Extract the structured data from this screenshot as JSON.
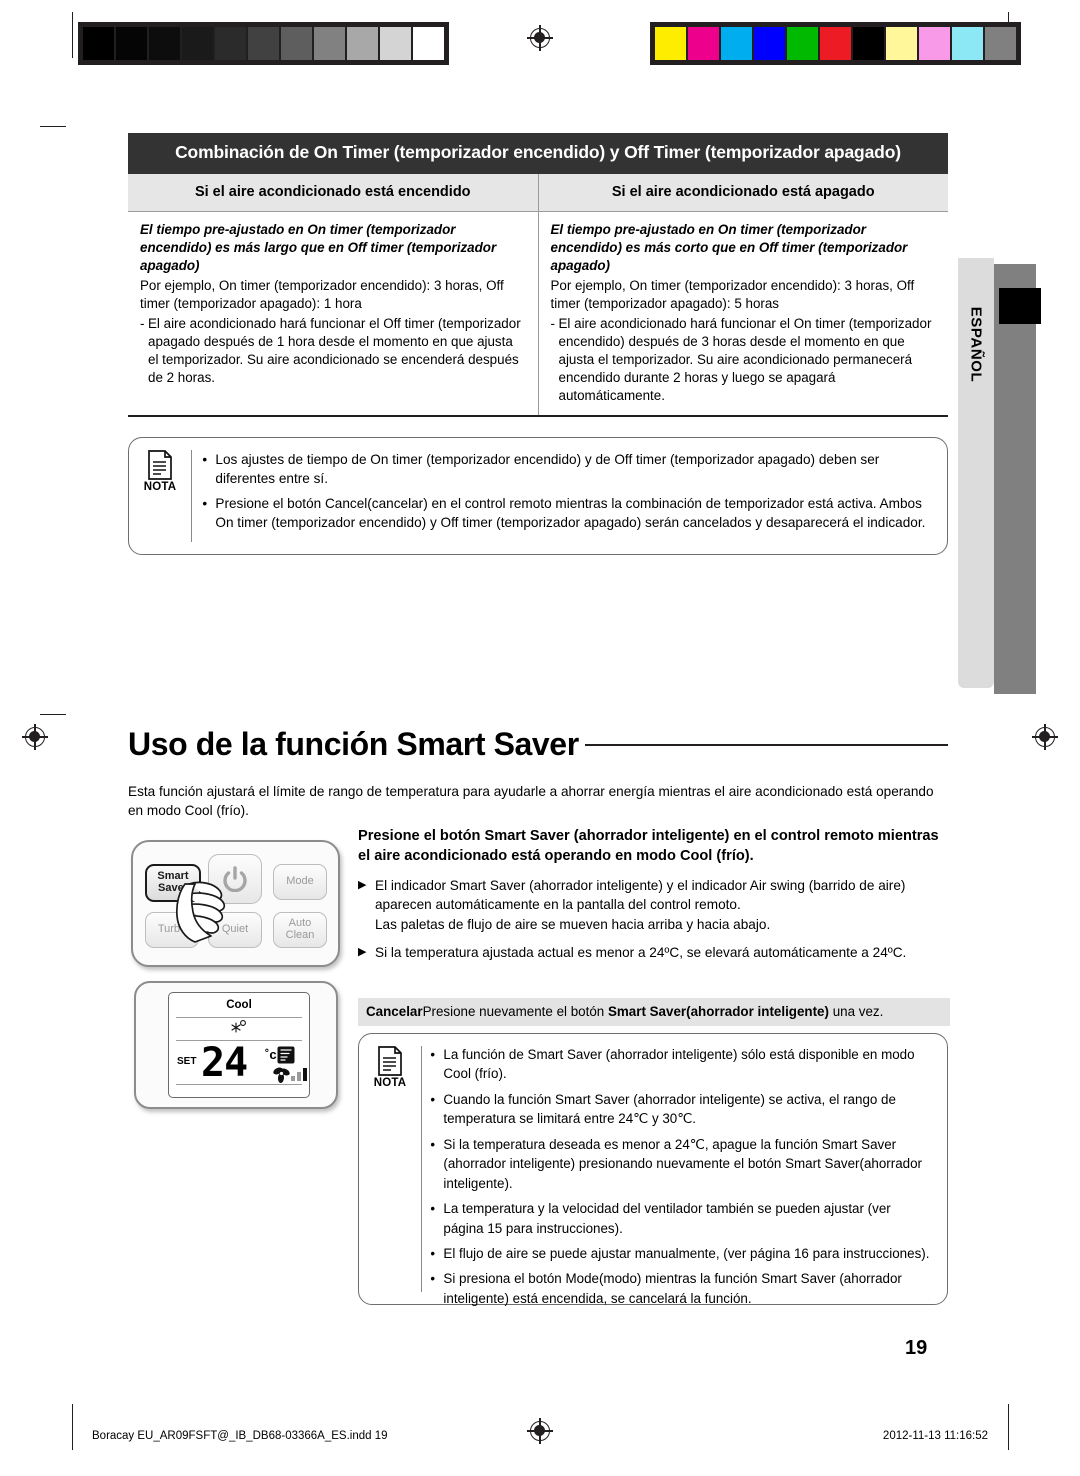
{
  "calibration": {
    "gray_swatches": [
      "#000000",
      "#050505",
      "#0d0d0d",
      "#1a1a1a",
      "#2b2b2b",
      "#414141",
      "#5e5e5e",
      "#818181",
      "#a8a8a8",
      "#d4d4d4",
      "#ffffff"
    ],
    "color_swatches": [
      "#ffed00",
      "#ec008c",
      "#00aeef",
      "#0000ff",
      "#00b900",
      "#ed1c24",
      "#000000",
      "#fff79a",
      "#f89ae8",
      "#8de8f5",
      "#808080"
    ]
  },
  "language_tab": {
    "label": "ESPAÑOL"
  },
  "table": {
    "title": "Combinación de On Timer (temporizador encendido) y Off Timer (temporizador apagado)",
    "columns": [
      "Si el aire acondicionado está encendido",
      "Si el aire acondicionado está apagado"
    ],
    "rows": [
      {
        "heading": "El tiempo pre-ajustado en On timer (temporizador encendido) es más largo que en Off timer (temporizador apagado)",
        "example": "Por ejemplo, On timer (temporizador encendido): 3 horas, Off timer (temporizador apagado): 1 hora",
        "dash_mark": "-",
        "detail": "El aire acondicionado hará funcionar el Off timer (temporizador apagado después de 1 hora desde el momento en que ajusta el temporizador. Su aire acondicionado se encenderá después de 2 horas."
      },
      {
        "heading": "El tiempo pre-ajustado en On timer (temporizador encendido) es más corto que en Off timer (temporizador apagado)",
        "example": "Por ejemplo, On timer (temporizador encendido): 3 horas, Off timer (temporizador apagado): 5 horas",
        "dash_mark": "-",
        "detail": "El aire acondicionado hará funcionar el On timer (temporizador encendido) después de 3 horas desde el momento en que ajusta el temporizador. Su aire acondicionado permanecerá encendido durante 2 horas y luego se apagará automáticamente."
      }
    ]
  },
  "note1": {
    "label": "NOTA",
    "bullet": "•",
    "items": [
      "Los ajustes de tiempo de On timer (temporizador encendido) y de Off timer (temporizador apagado) deben ser diferentes entre sí.",
      "Presione el botón  Cancel(cancelar) en el control remoto mientras la combinación de temporizador está activa. Ambos On timer (temporizador encendido) y Off timer (temporizador apagado) serán cancelados y desaparecerá el indicador."
    ]
  },
  "section": {
    "title": "Uso de la función Smart Saver",
    "intro": "Esta función ajustará el límite de rango de temperatura para ayudarle a ahorrar energía mientras el aire acondicionado está operando en modo Cool (frío)."
  },
  "instructions": {
    "heading": "Presione el botón Smart Saver (ahorrador inteligente) en el control remoto mientras el aire acondicionado está operando en modo Cool (frío).",
    "arrow": "▶",
    "items": [
      "El indicador Smart Saver (ahorrador inteligente) y el indicador Air swing (barrido de aire) aparecen automáticamente en la pantalla del control remoto.\nLas paletas de flujo de aire se mueven hacia arriba y hacia abajo.",
      "Si la temperatura ajustada actual es menor a 24ºC, se elevará automáticamente a 24ºC."
    ],
    "cancel_label": "Cancelar",
    "cancel_text_1": "Presione nuevamente el botón ",
    "cancel_bold": "Smart Saver(ahorrador inteligente)",
    "cancel_text_2": " una vez."
  },
  "remote": {
    "buttons": {
      "smart_saver": "Smart\nSaver",
      "power": "power-icon",
      "mode": "Mode",
      "turbo": "Turbo",
      "quiet": "Quiet",
      "auto_clean": "Auto\nClean"
    }
  },
  "lcd": {
    "mode": "Cool",
    "set_label": "SET",
    "temperature": "24",
    "degree": "˚c",
    "snow_icon": "snowflake-icon",
    "swing_icon": "air-swing-icon",
    "fan_icon": "fan-icon",
    "fan_bars": 3
  },
  "note2": {
    "label": "NOTA",
    "bullet": "•",
    "items": [
      "La función de Smart Saver (ahorrador inteligente) sólo está disponible en modo Cool (frío).",
      "Cuando la función Smart Saver (ahorrador inteligente) se activa, el rango de temperatura se limitará entre 24℃ y 30℃.",
      "Si la temperatura deseada es menor a 24℃, apague la función Smart Saver (ahorrador inteligente) presionando nuevamente el botón Smart Saver(ahorrador inteligente).",
      "La temperatura y la velocidad del ventilador también se pueden ajustar (ver página 15 para instrucciones).",
      "El flujo de aire se puede ajustar manualmente, (ver página 16 para instrucciones).",
      "Si presiona el botón Mode(modo) mientras la función Smart Saver (ahorrador inteligente) está encendida, se cancelará la función."
    ]
  },
  "footer": {
    "page_number": "19",
    "file_name": "Boracay EU_AR09FSFT@_IB_DB68-03366A_ES.indd   19",
    "timestamp": "2012-11-13   11:16:52"
  }
}
